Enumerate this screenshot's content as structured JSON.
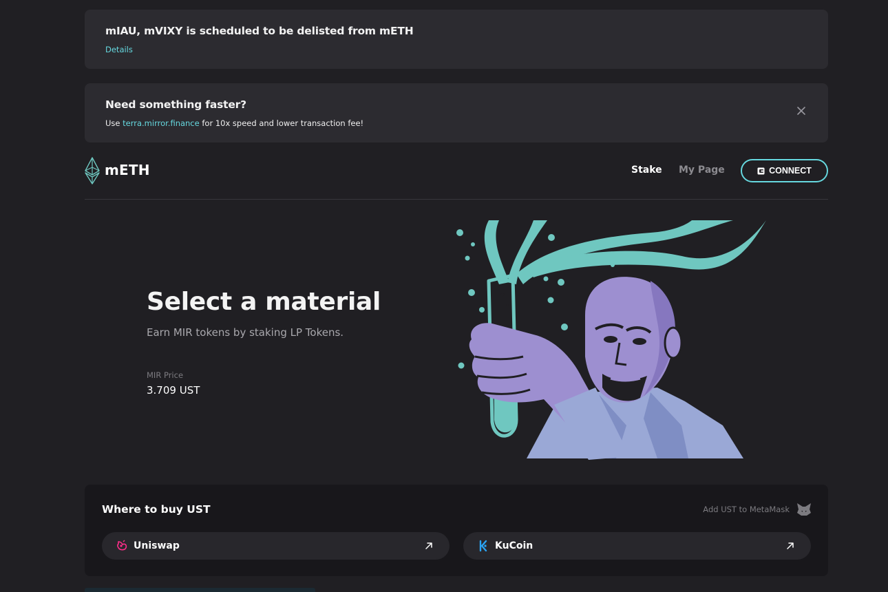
{
  "notices": [
    {
      "title": "mIAU, mVIXY is scheduled to be delisted from mETH",
      "link": "Details"
    },
    {
      "title": "Need something faster?",
      "prefix": "Use ",
      "link": "terra.mirror.finance",
      "suffix": " for 10x speed and lower transaction fee!"
    }
  ],
  "header": {
    "brand": "mETH",
    "nav": {
      "stake": "Stake",
      "my_page": "My Page"
    },
    "connect_label": "CONNECT"
  },
  "hero": {
    "title": "Select a material",
    "subtitle": "Earn MIR tokens by staking LP Tokens.",
    "price_label": "MIR Price",
    "price_value": "3.709 UST"
  },
  "buy": {
    "title": "Where to buy UST",
    "metamask_label": "Add UST to MetaMask",
    "exchanges": [
      {
        "name": "Uniswap",
        "icon": "uniswap-icon"
      },
      {
        "name": "KuCoin",
        "icon": "kucoin-icon"
      }
    ]
  },
  "colors": {
    "background": "#201f23",
    "card": "#2c2b30",
    "accent": "#66d9e0",
    "illustration_purple": "#9d8fd0",
    "illustration_teal": "#6fc7c0"
  }
}
